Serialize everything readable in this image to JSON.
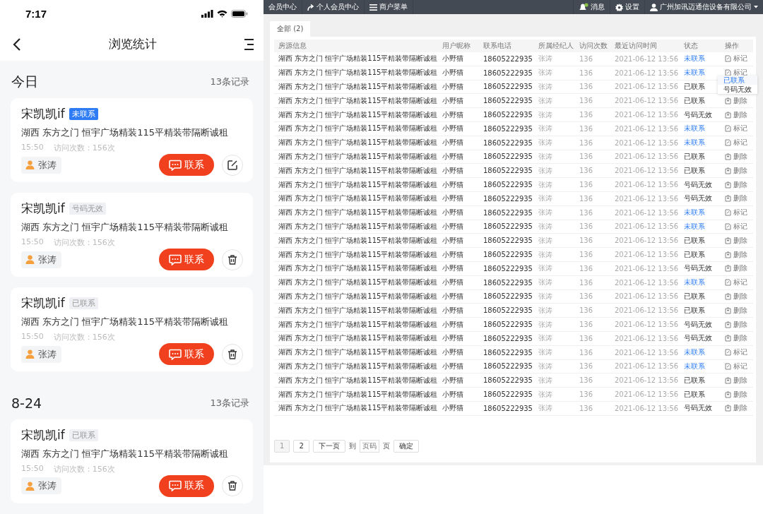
{
  "phone": {
    "status_bar": {
      "time": "7:17"
    },
    "nav": {
      "title": "浏览统计"
    },
    "sections": [
      {
        "title": "今日",
        "count": "13条记录",
        "cards": [
          {
            "name": "宋凯凯if",
            "status": {
              "label": "未联系",
              "kind": "uncontacted"
            },
            "address": "湖西 东方之门 恒宇广场精装115平精装带隔断诚租",
            "time": "15:50",
            "visits": "访问次数：156次",
            "agent": "张涛",
            "contact": "联系",
            "action": {
              "kind": "edit"
            }
          },
          {
            "name": "宋凯凯if",
            "status": {
              "label": "号码无效",
              "kind": "invalid"
            },
            "address": "湖西 东方之门 恒宇广场精装115平精装带隔断诚租",
            "time": "15:50",
            "visits": "访问次数：156次",
            "agent": "张涛",
            "contact": "联系",
            "action": {
              "kind": "delete"
            }
          },
          {
            "name": "宋凯凯if",
            "status": {
              "label": "已联系",
              "kind": "contacted"
            },
            "address": "湖西 东方之门 恒宇广场精装115平精装带隔断诚租",
            "time": "15:50",
            "visits": "访问次数：156次",
            "agent": "张涛",
            "contact": "联系",
            "action": {
              "kind": "delete"
            }
          }
        ]
      },
      {
        "title": "8-24",
        "count": "13条记录",
        "cards": [
          {
            "name": "宋凯凯if",
            "status": {
              "label": "已联系",
              "kind": "contacted"
            },
            "address": "湖西 东方之门 恒宇广场精装115平精装带隔断诚租",
            "time": "15:50",
            "visits": "访问次数：156次",
            "agent": "张涛",
            "contact": "联系",
            "action": {
              "kind": "delete"
            }
          }
        ]
      }
    ]
  },
  "admin": {
    "top_bar": {
      "member_center": "会员中心",
      "personal_center": "个人会员中心",
      "merchant_menu": "商户菜单",
      "messages": "消息",
      "settings": "设置",
      "account": "广州加讯迈通信设备有限公司"
    },
    "tabs": [
      {
        "label": "全部 (2)",
        "selected": true
      }
    ],
    "table": {
      "columns": [
        "房源信息",
        "用户昵称",
        "联系电话",
        "所属经纪人",
        "访问次数",
        "最近访问时间",
        "状态",
        "操作"
      ],
      "rows": [
        {
          "info": "湖西 东方之门 恒宇广场精装115平精装带隔断诚租",
          "nickname": "小野猫",
          "phone": "18605222935",
          "agent": "张涛",
          "visits": "136",
          "time": "2021-06-12 13:56",
          "status": {
            "label": "未联系",
            "kind": "uncontacted"
          },
          "action": {
            "label": "标记",
            "kind": "mark"
          }
        },
        {
          "info": "湖西 东方之门 恒宇广场精装115平精装带隔断诚租",
          "nickname": "小野猫",
          "phone": "18605222935",
          "agent": "张涛",
          "visits": "136",
          "time": "2021-06-12 13:56",
          "status": {
            "label": "未联系",
            "kind": "uncontacted"
          },
          "action": {
            "label": "标记",
            "kind": "mark",
            "menu": [
              {
                "label": "已联系",
                "selected": true
              },
              {
                "label": "号码无效",
                "selected": false
              }
            ]
          }
        },
        {
          "info": "湖西 东方之门 恒宇广场精装115平精装带隔断诚租",
          "nickname": "小野猫",
          "phone": "18605222935",
          "agent": "张涛",
          "visits": "136",
          "time": "2021-06-12 13:56",
          "status": {
            "label": "已联系",
            "kind": "contacted"
          }
        },
        {
          "info": "湖西 东方之门 恒宇广场精装115平精装带隔断诚租",
          "nickname": "小野猫",
          "phone": "18605222935",
          "agent": "张涛",
          "visits": "136",
          "time": "2021-06-12 13:56",
          "status": {
            "label": "已联系",
            "kind": "contacted"
          },
          "action": {
            "label": "删除",
            "kind": "delete"
          }
        },
        {
          "info": "湖西 东方之门 恒宇广场精装115平精装带隔断诚租",
          "nickname": "小野猫",
          "phone": "18605222935",
          "agent": "张涛",
          "visits": "136",
          "time": "2021-06-12 13:56",
          "status": {
            "label": "号码无效",
            "kind": "invalid"
          },
          "action": {
            "label": "删除",
            "kind": "delete"
          }
        },
        {
          "info": "湖西 东方之门 恒宇广场精装115平精装带隔断诚租",
          "nickname": "小野猫",
          "phone": "18605222935",
          "agent": "张涛",
          "visits": "136",
          "time": "2021-06-12 13:56",
          "status": {
            "label": "未联系",
            "kind": "uncontacted"
          },
          "action": {
            "label": "标记",
            "kind": "mark"
          }
        },
        {
          "info": "湖西 东方之门 恒宇广场精装115平精装带隔断诚租",
          "nickname": "小野猫",
          "phone": "18605222935",
          "agent": "张涛",
          "visits": "136",
          "time": "2021-06-12 13:56",
          "status": {
            "label": "未联系",
            "kind": "uncontacted"
          },
          "action": {
            "label": "标记",
            "kind": "mark"
          }
        },
        {
          "info": "湖西 东方之门 恒宇广场精装115平精装带隔断诚租",
          "nickname": "小野猫",
          "phone": "18605222935",
          "agent": "张涛",
          "visits": "136",
          "time": "2021-06-12 13:56",
          "status": {
            "label": "已联系",
            "kind": "contacted"
          },
          "action": {
            "label": "删除",
            "kind": "delete"
          }
        },
        {
          "info": "湖西 东方之门 恒宇广场精装115平精装带隔断诚租",
          "nickname": "小野猫",
          "phone": "18605222935",
          "agent": "张涛",
          "visits": "136",
          "time": "2021-06-12 13:56",
          "status": {
            "label": "已联系",
            "kind": "contacted"
          },
          "action": {
            "label": "删除",
            "kind": "delete"
          }
        },
        {
          "info": "湖西 东方之门 恒宇广场精装115平精装带隔断诚租",
          "nickname": "小野猫",
          "phone": "18605222935",
          "agent": "张涛",
          "visits": "136",
          "time": "2021-06-12 13:56",
          "status": {
            "label": "号码无效",
            "kind": "invalid"
          },
          "action": {
            "label": "删除",
            "kind": "delete"
          }
        },
        {
          "info": "湖西 东方之门 恒宇广场精装115平精装带隔断诚租",
          "nickname": "小野猫",
          "phone": "18605222935",
          "agent": "张涛",
          "visits": "136",
          "time": "2021-06-12 13:56",
          "status": {
            "label": "号码无效",
            "kind": "invalid"
          },
          "action": {
            "label": "删除",
            "kind": "delete"
          }
        },
        {
          "info": "湖西 东方之门 恒宇广场精装115平精装带隔断诚租",
          "nickname": "小野猫",
          "phone": "18605222935",
          "agent": "张涛",
          "visits": "136",
          "time": "2021-06-12 13:56",
          "status": {
            "label": "未联系",
            "kind": "uncontacted"
          },
          "action": {
            "label": "标记",
            "kind": "mark"
          }
        },
        {
          "info": "湖西 东方之门 恒宇广场精装115平精装带隔断诚租",
          "nickname": "小野猫",
          "phone": "18605222935",
          "agent": "张涛",
          "visits": "136",
          "time": "2021-06-12 13:56",
          "status": {
            "label": "未联系",
            "kind": "uncontacted"
          },
          "action": {
            "label": "标记",
            "kind": "mark"
          }
        },
        {
          "info": "湖西 东方之门 恒宇广场精装115平精装带隔断诚租",
          "nickname": "小野猫",
          "phone": "18605222935",
          "agent": "张涛",
          "visits": "136",
          "time": "2021-06-12 13:56",
          "status": {
            "label": "已联系",
            "kind": "contacted"
          },
          "action": {
            "label": "删除",
            "kind": "delete"
          }
        },
        {
          "info": "湖西 东方之门 恒宇广场精装115平精装带隔断诚租",
          "nickname": "小野猫",
          "phone": "18605222935",
          "agent": "张涛",
          "visits": "136",
          "time": "2021-06-12 13:56",
          "status": {
            "label": "已联系",
            "kind": "contacted"
          },
          "action": {
            "label": "删除",
            "kind": "delete"
          }
        },
        {
          "info": "湖西 东方之门 恒宇广场精装115平精装带隔断诚租",
          "nickname": "小野猫",
          "phone": "18605222935",
          "agent": "张涛",
          "visits": "136",
          "time": "2021-06-12 13:56",
          "status": {
            "label": "号码无效",
            "kind": "invalid"
          },
          "action": {
            "label": "删除",
            "kind": "delete"
          }
        },
        {
          "info": "湖西 东方之门 恒宇广场精装115平精装带隔断诚租",
          "nickname": "小野猫",
          "phone": "18605222935",
          "agent": "张涛",
          "visits": "136",
          "time": "2021-06-12 13:56",
          "status": {
            "label": "未联系",
            "kind": "uncontacted"
          },
          "action": {
            "label": "标记",
            "kind": "mark"
          }
        },
        {
          "info": "湖西 东方之门 恒宇广场精装115平精装带隔断诚租",
          "nickname": "小野猫",
          "phone": "18605222935",
          "agent": "张涛",
          "visits": "136",
          "time": "2021-06-12 13:56",
          "status": {
            "label": "已联系",
            "kind": "contacted"
          },
          "action": {
            "label": "删除",
            "kind": "delete"
          }
        },
        {
          "info": "湖西 东方之门 恒宇广场精装115平精装带隔断诚租",
          "nickname": "小野猫",
          "phone": "18605222935",
          "agent": "张涛",
          "visits": "136",
          "time": "2021-06-12 13:56",
          "status": {
            "label": "已联系",
            "kind": "contacted"
          },
          "action": {
            "label": "删除",
            "kind": "delete"
          }
        },
        {
          "info": "湖西 东方之门 恒宇广场精装115平精装带隔断诚租",
          "nickname": "小野猫",
          "phone": "18605222935",
          "agent": "张涛",
          "visits": "136",
          "time": "2021-06-12 13:56",
          "status": {
            "label": "号码无效",
            "kind": "invalid"
          },
          "action": {
            "label": "删除",
            "kind": "delete"
          }
        },
        {
          "info": "湖西 东方之门 恒宇广场精装115平精装带隔断诚租",
          "nickname": "小野猫",
          "phone": "18605222935",
          "agent": "张涛",
          "visits": "136",
          "time": "2021-06-12 13:56",
          "status": {
            "label": "号码无效",
            "kind": "invalid"
          },
          "action": {
            "label": "删除",
            "kind": "delete"
          }
        },
        {
          "info": "湖西 东方之门 恒宇广场精装115平精装带隔断诚租",
          "nickname": "小野猫",
          "phone": "18605222935",
          "agent": "张涛",
          "visits": "136",
          "time": "2021-06-12 13:56",
          "status": {
            "label": "未联系",
            "kind": "uncontacted"
          },
          "action": {
            "label": "标记",
            "kind": "mark"
          }
        },
        {
          "info": "湖西 东方之门 恒宇广场精装115平精装带隔断诚租",
          "nickname": "小野猫",
          "phone": "18605222935",
          "agent": "张涛",
          "visits": "136",
          "time": "2021-06-12 13:56",
          "status": {
            "label": "未联系",
            "kind": "uncontacted"
          },
          "action": {
            "label": "标记",
            "kind": "mark"
          }
        },
        {
          "info": "湖西 东方之门 恒宇广场精装115平精装带隔断诚租",
          "nickname": "小野猫",
          "phone": "18605222935",
          "agent": "张涛",
          "visits": "136",
          "time": "2021-06-12 13:56",
          "status": {
            "label": "已联系",
            "kind": "contacted"
          },
          "action": {
            "label": "删除",
            "kind": "delete"
          }
        },
        {
          "info": "湖西 东方之门 恒宇广场精装115平精装带隔断诚租",
          "nickname": "小野猫",
          "phone": "18605222935",
          "agent": "张涛",
          "visits": "136",
          "time": "2021-06-12 13:56",
          "status": {
            "label": "已联系",
            "kind": "contacted"
          },
          "action": {
            "label": "删除",
            "kind": "delete"
          }
        },
        {
          "info": "湖西 东方之门 恒宇广场精装115平精装带隔断诚租",
          "nickname": "小野猫",
          "phone": "18605222935",
          "agent": "张涛",
          "visits": "136",
          "time": "2021-06-12 13:56",
          "status": {
            "label": "号码无效",
            "kind": "invalid"
          },
          "action": {
            "label": "删除",
            "kind": "delete"
          }
        }
      ]
    },
    "pagination": {
      "pages": [
        {
          "label": "1",
          "disabled": true
        },
        {
          "label": "2",
          "disabled": false
        }
      ],
      "next": "下一页",
      "goto": "到",
      "placeholder": "页码",
      "unit": "页",
      "confirm": "确定"
    }
  }
}
